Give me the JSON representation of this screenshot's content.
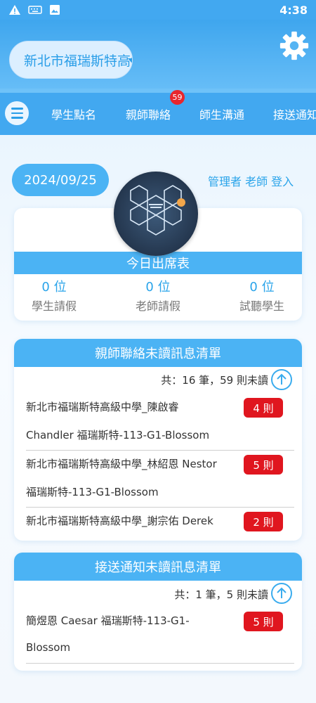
{
  "status_bar": {
    "time": "4:38",
    "icons": [
      "warning-icon",
      "keyboard-icon",
      "image-icon"
    ]
  },
  "header": {
    "school_name": "新北市福瑞斯特高級中學",
    "settings_icon": "gear-icon"
  },
  "nav": {
    "items": [
      "學生點名",
      "親師聯絡",
      "師生溝通",
      "接送通知"
    ],
    "badge": "59"
  },
  "dashboard": {
    "date": "2024/09/25",
    "login_text": "管理者 老師 登入",
    "attendance_title": "今日出席表",
    "stats": [
      {
        "value": "0 位",
        "label": "學生請假"
      },
      {
        "value": "0 位",
        "label": "老師請假"
      },
      {
        "value": "0 位",
        "label": "試聽學生"
      }
    ]
  },
  "parent_teacher": {
    "title": "親師聯絡未讀訊息清單",
    "summary": "共：16 筆，59 則未讀",
    "rows": [
      {
        "line1": "新北市福瑞斯特高級中學_陳啟睿",
        "line2": "Chandler 福瑞斯特-113-G1-Blossom",
        "count": "4 則"
      },
      {
        "line1": "新北市福瑞斯特高級中學_林紹恩 Nestor",
        "line2": "福瑞斯特-113-G1-Blossom",
        "count": "5 則"
      },
      {
        "line1": "新北市福瑞斯特高級中學_謝宗佑 Derek",
        "line2": "",
        "count": "2 則"
      }
    ]
  },
  "pickup": {
    "title": "接送通知未讀訊息清單",
    "summary": "共：1 筆，5 則未讀",
    "rows": [
      {
        "line1": "簡煜恩 Caesar 福瑞斯特-113-G1-",
        "line2": "Blossom",
        "count": "5 則"
      }
    ]
  },
  "colors": {
    "primary": "#42a8f0",
    "accent_text": "#2aa4ea",
    "alert": "#e0161f"
  }
}
